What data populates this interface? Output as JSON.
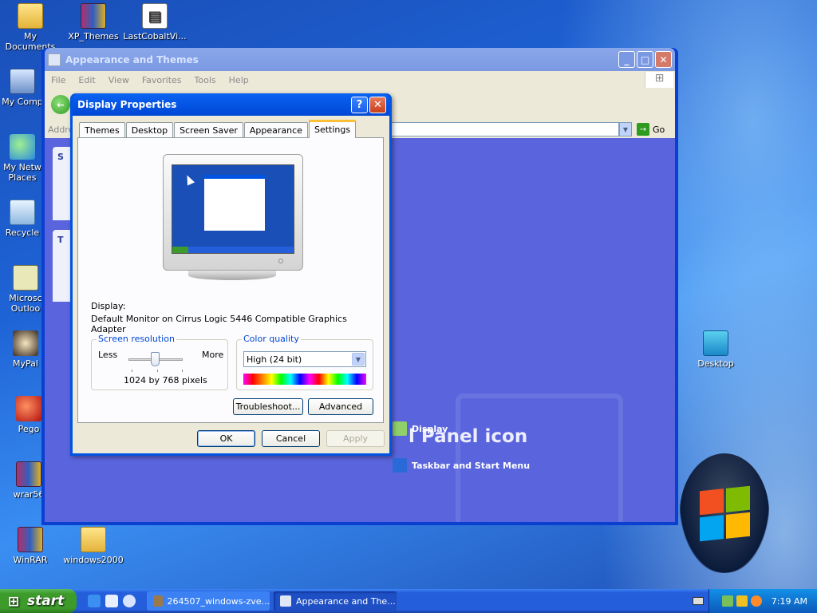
{
  "desktop_icons": [
    {
      "label": "My Documents",
      "icon": "folder-icon"
    },
    {
      "label": "XP_Themes",
      "icon": "winrar-archive-icon"
    },
    {
      "label": "LastCobaltVi...",
      "icon": "document-icon"
    },
    {
      "label": "My Comp",
      "icon": "my-computer-icon"
    },
    {
      "label": "My Netw",
      "label2": "Places",
      "icon": "network-places-icon"
    },
    {
      "label": "Recycle",
      "icon": "recycle-bin-icon"
    },
    {
      "label": "Microsc",
      "label2": "Outloo",
      "icon": "outlook-icon"
    },
    {
      "label": "MyPal",
      "icon": "mypal-icon"
    },
    {
      "label": "Pego",
      "icon": "pego-icon"
    },
    {
      "label": "wrar56",
      "icon": "winrar-installer-icon"
    },
    {
      "label": "WinRAR",
      "icon": "winrar-icon"
    },
    {
      "label": "windows2000",
      "icon": "folder-icon"
    },
    {
      "label": "Desktop",
      "icon": "monitor-icon"
    }
  ],
  "explorer": {
    "title": "Appearance and Themes",
    "menu": [
      "File",
      "Edit",
      "View",
      "Favorites",
      "Tools",
      "Help"
    ],
    "address_label": "Addre",
    "go_label": "Go",
    "side_panel_headers": [
      "S",
      "T"
    ],
    "heading": "l Panel icon",
    "links": [
      "Display",
      "Taskbar and Start Menu"
    ]
  },
  "dialog": {
    "title": "Display Properties",
    "help_glyph": "?",
    "close_glyph": "✕",
    "tabs": [
      "Themes",
      "Desktop",
      "Screen Saver",
      "Appearance",
      "Settings"
    ],
    "active_tab": "Settings",
    "display_label": "Display:",
    "display_value": "Default Monitor on Cirrus Logic 5446 Compatible Graphics Adapter",
    "resolution": {
      "title": "Screen resolution",
      "less": "Less",
      "more": "More",
      "value": "1024 by 768 pixels",
      "slider_fraction": 0.5
    },
    "color_quality": {
      "title": "Color quality",
      "selected": "High (24 bit)"
    },
    "buttons": {
      "troubleshoot": "Troubleshoot...",
      "advanced": "Advanced",
      "ok": "OK",
      "cancel": "Cancel",
      "apply": "Apply"
    }
  },
  "taskbar": {
    "start_label": "start",
    "tasks": [
      {
        "label": "264507_windows-zve...",
        "icon": "app-icon",
        "active": false
      },
      {
        "label": "Appearance and The...",
        "icon": "control-panel-icon",
        "active": true
      }
    ],
    "clock": "7:19 AM"
  },
  "colors": {
    "xp_blue": "#0054e3",
    "start_green": "#3c9b2a",
    "panel_blue": "#5a65dd",
    "dialog_face": "#ece9d8"
  }
}
